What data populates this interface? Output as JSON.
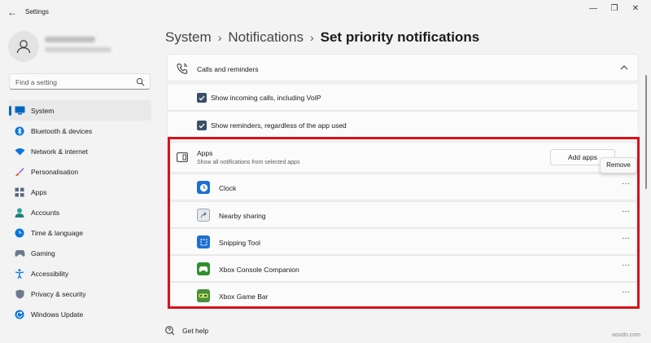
{
  "window": {
    "title": "Settings",
    "back_icon": "arrow-left-icon",
    "minimize_icon": "minimize-icon",
    "maximize_icon": "maximize-icon",
    "close_icon": "close-icon"
  },
  "profile": {
    "avatar_icon": "person-icon"
  },
  "search": {
    "placeholder": "Find a setting"
  },
  "sidebar": {
    "items": [
      {
        "label": "System",
        "icon": "monitor-icon",
        "active": true,
        "color": "#0067c0"
      },
      {
        "label": "Bluetooth & devices",
        "icon": "bluetooth-icon",
        "color": "#0a74da"
      },
      {
        "label": "Network & internet",
        "icon": "wifi-icon",
        "color": "#0a74da"
      },
      {
        "label": "Personalisation",
        "icon": "brush-icon",
        "color": "#d96f3a"
      },
      {
        "label": "Apps",
        "icon": "apps-grid-icon",
        "color": "#5a6b80"
      },
      {
        "label": "Accounts",
        "icon": "account-icon",
        "color": "#2aa198"
      },
      {
        "label": "Time & language",
        "icon": "globe-clock-icon",
        "color": "#0a74da"
      },
      {
        "label": "Gaming",
        "icon": "gamepad-icon",
        "color": "#6b7a8c"
      },
      {
        "label": "Accessibility",
        "icon": "accessibility-icon",
        "color": "#0a74da"
      },
      {
        "label": "Privacy & security",
        "icon": "shield-icon",
        "color": "#6b7a8c"
      },
      {
        "label": "Windows Update",
        "icon": "refresh-icon",
        "color": "#0a74da"
      }
    ]
  },
  "breadcrumb": {
    "items": [
      "System",
      "Notifications"
    ],
    "current": "Set priority notifications"
  },
  "calls": {
    "title": "Calls and reminders",
    "option1": "Show incoming calls, including VoIP",
    "option2": "Show reminders, regardless of the app used"
  },
  "apps": {
    "title": "Apps",
    "subtitle": "Show all notifications from selected apps",
    "add_button": "Add apps",
    "remove_tooltip": "Remove",
    "list": [
      {
        "name": "Clock",
        "icon": "clock-icon",
        "color": "#1e6fd1"
      },
      {
        "name": "Nearby sharing",
        "icon": "share-icon",
        "color": "#7a8a99"
      },
      {
        "name": "Snipping Tool",
        "icon": "scissors-icon",
        "color": "#1e6fd1"
      },
      {
        "name": "Xbox Console Companion",
        "icon": "xbox-icon",
        "color": "#2f8f2f"
      },
      {
        "name": "Xbox Game Bar",
        "icon": "gamebar-icon",
        "color": "#4a8f3a"
      }
    ]
  },
  "help": {
    "label": "Get help",
    "icon": "help-icon"
  },
  "watermark": "wsxdn.com",
  "highlight_color": "#d9121b"
}
